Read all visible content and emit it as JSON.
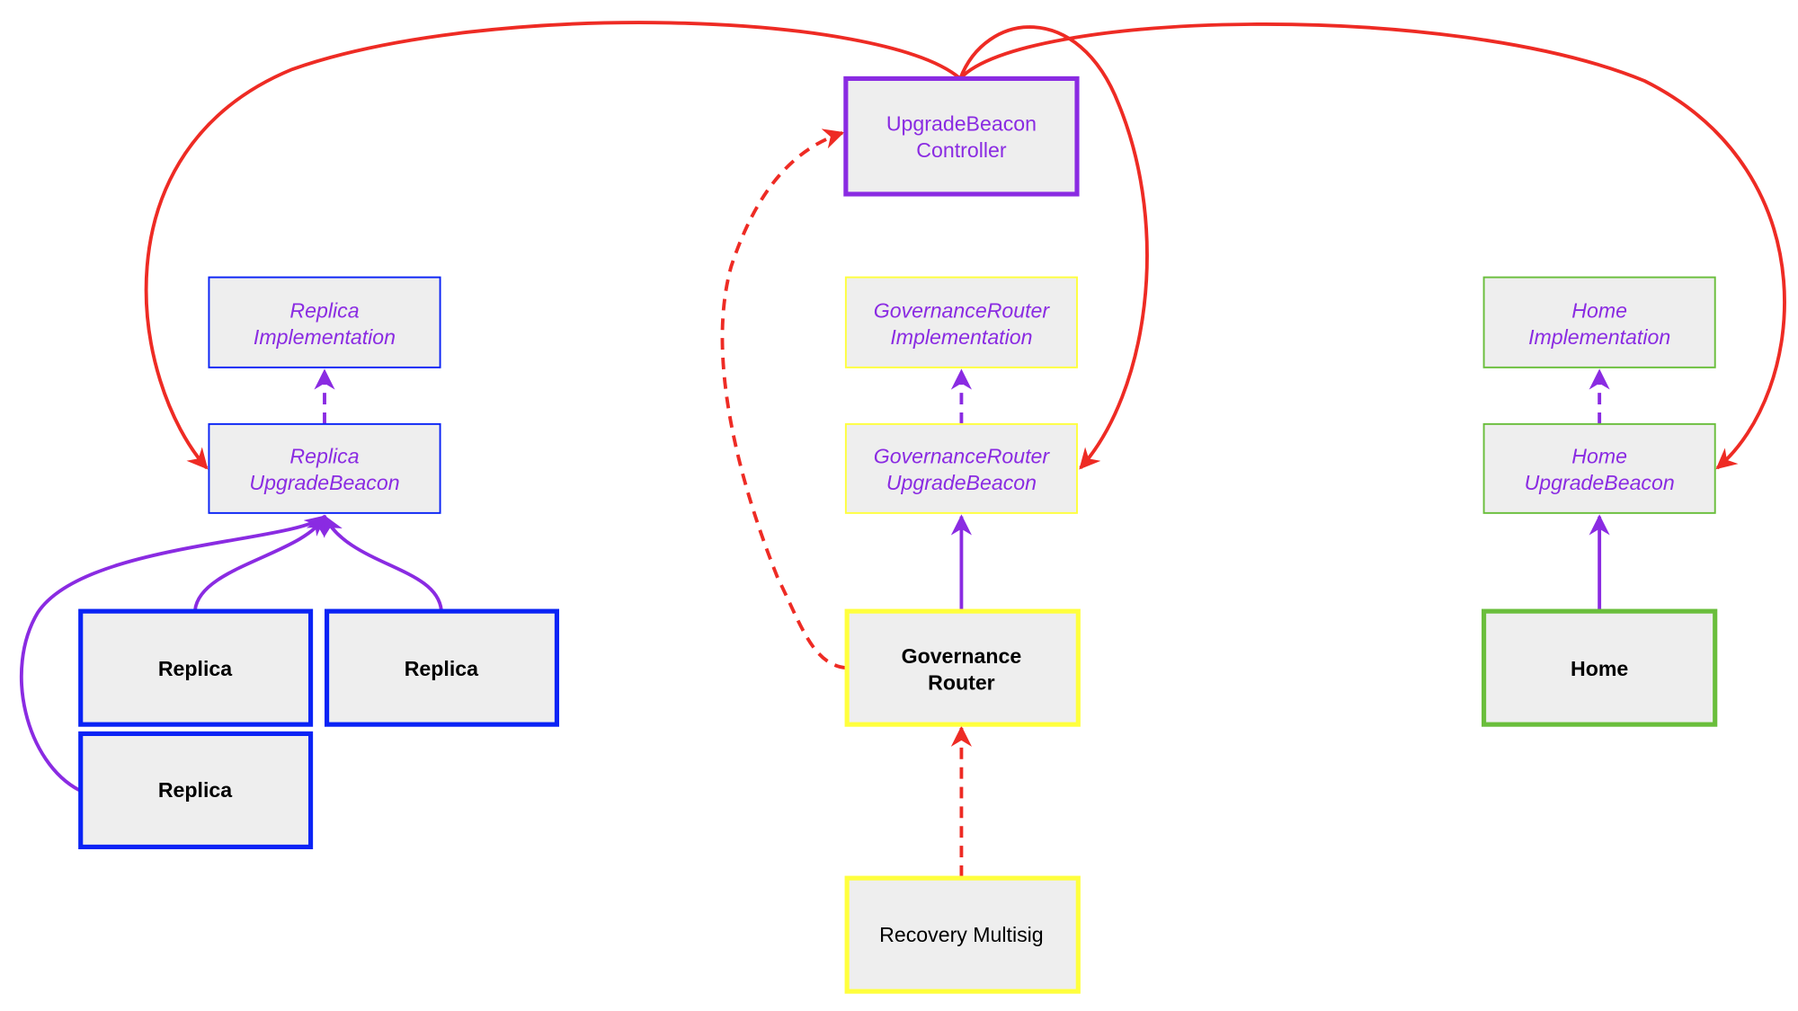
{
  "colors": {
    "red": "#ee2b24",
    "purple": "#8a2be2",
    "blue": "#0a23f5",
    "yellow": "#ffff3d",
    "green": "#6abe3c",
    "fill": "#eeeeee"
  },
  "nodes": {
    "ubc": {
      "line1": "UpgradeBeacon",
      "line2": "Controller"
    },
    "replica_impl": {
      "line1": "Replica",
      "line2": "Implementation"
    },
    "replica_ub": {
      "line1": "Replica",
      "line2": "UpgradeBeacon"
    },
    "gr_impl": {
      "line1": "GovernanceRouter",
      "line2": "Implementation"
    },
    "gr_ub": {
      "line1": "GovernanceRouter",
      "line2": "UpgradeBeacon"
    },
    "home_impl": {
      "line1": "Home",
      "line2": "Implementation"
    },
    "home_ub": {
      "line1": "Home",
      "line2": "UpgradeBeacon"
    },
    "replica1": {
      "label": "Replica"
    },
    "replica2": {
      "label": "Replica"
    },
    "replica3": {
      "label": "Replica"
    },
    "gr": {
      "line1": "Governance",
      "line2": "Router"
    },
    "home": {
      "label": "Home"
    },
    "recovery": {
      "label": "Recovery Multisig"
    }
  }
}
